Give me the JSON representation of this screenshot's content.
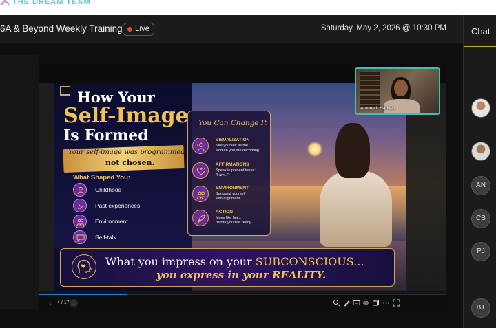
{
  "brand": {
    "name": "THE DREAM TEAM"
  },
  "event": {
    "title": "6A & Beyond Weekly Training",
    "live_label": "Live",
    "datetime": "Saturday, May 2, 2026 @ 10:30 PM"
  },
  "slide": {
    "title_line1": "How Your",
    "title_line2": "Self-Image",
    "title_line3": "Is Formed",
    "programmed_line1": "Your self-image was programmed...",
    "programmed_line2": "not chosen.",
    "shaped_title": "What Shaped You:",
    "shaped_items": [
      {
        "label": "Childhood",
        "icon": "child-icon"
      },
      {
        "label": "Past experiences",
        "icon": "hand-icon"
      },
      {
        "label": "Environment",
        "icon": "people-icon"
      },
      {
        "label": "Self-talk",
        "icon": "speech-bubble-icon"
      }
    ],
    "change_title": "You Can Change It",
    "change_items": [
      {
        "name": "VISUALIZATION",
        "desc1": "See yourself as the",
        "desc2": "woman you are becoming.",
        "icon": "sun-person-icon"
      },
      {
        "name": "AFFIRMATIONS",
        "desc1": "Speak in present tense:",
        "desc2": "\"I am...\"",
        "icon": "heart-icon"
      },
      {
        "name": "ENVIRONMENT",
        "desc1": "Surround yourself",
        "desc2": "with alignment.",
        "icon": "people-icon"
      },
      {
        "name": "ACTION",
        "desc1": "Move like her...",
        "desc2": "before you feel ready.",
        "icon": "rocket-icon"
      }
    ],
    "bottom_line1_pre": "What you impress on your ",
    "bottom_line1_highlight": "SUBCONSCIOUS...",
    "bottom_line2": "you express in your REALITY."
  },
  "viewer": {
    "page_indicator": "4 / 17",
    "progress": 0.215,
    "tools": [
      "zoom-icon",
      "pen-icon",
      "caption-icon",
      "audio-icon",
      "copy-icon",
      "more-icon",
      "fullscreen-icon"
    ]
  },
  "camera": {
    "name": "Aranneth Hansen"
  },
  "chat": {
    "title": "Chat",
    "avatars": [
      {
        "initials": "",
        "type": "photo"
      },
      {
        "initials": "",
        "type": "photo"
      },
      {
        "initials": "AN",
        "type": "initials"
      },
      {
        "initials": "CB",
        "type": "initials"
      },
      {
        "initials": "PJ",
        "type": "initials"
      },
      {
        "initials": "BT",
        "type": "initials"
      }
    ]
  },
  "colors": {
    "accent_gold": "#f0c25a",
    "live_dot": "#e5483b",
    "progress": "#2f78e0",
    "camera_border": "#39c3b5",
    "brand": "#6ec4cf"
  }
}
